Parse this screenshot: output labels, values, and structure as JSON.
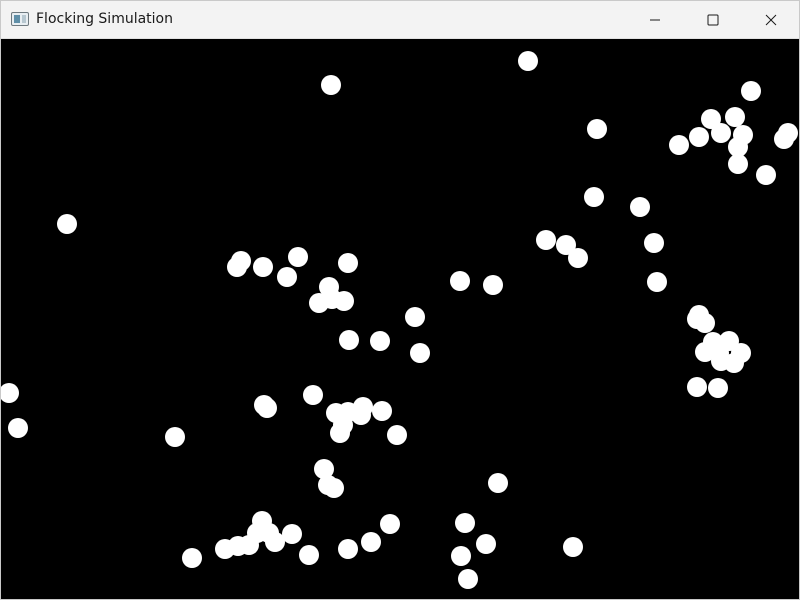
{
  "window": {
    "title": "Flocking Simulation"
  },
  "controls": {
    "minimize_icon": "minimize-icon",
    "maximize_icon": "maximize-icon",
    "close_icon": "close-icon"
  },
  "colors": {
    "boid": "#ffffff",
    "background": "#000000"
  }
}
